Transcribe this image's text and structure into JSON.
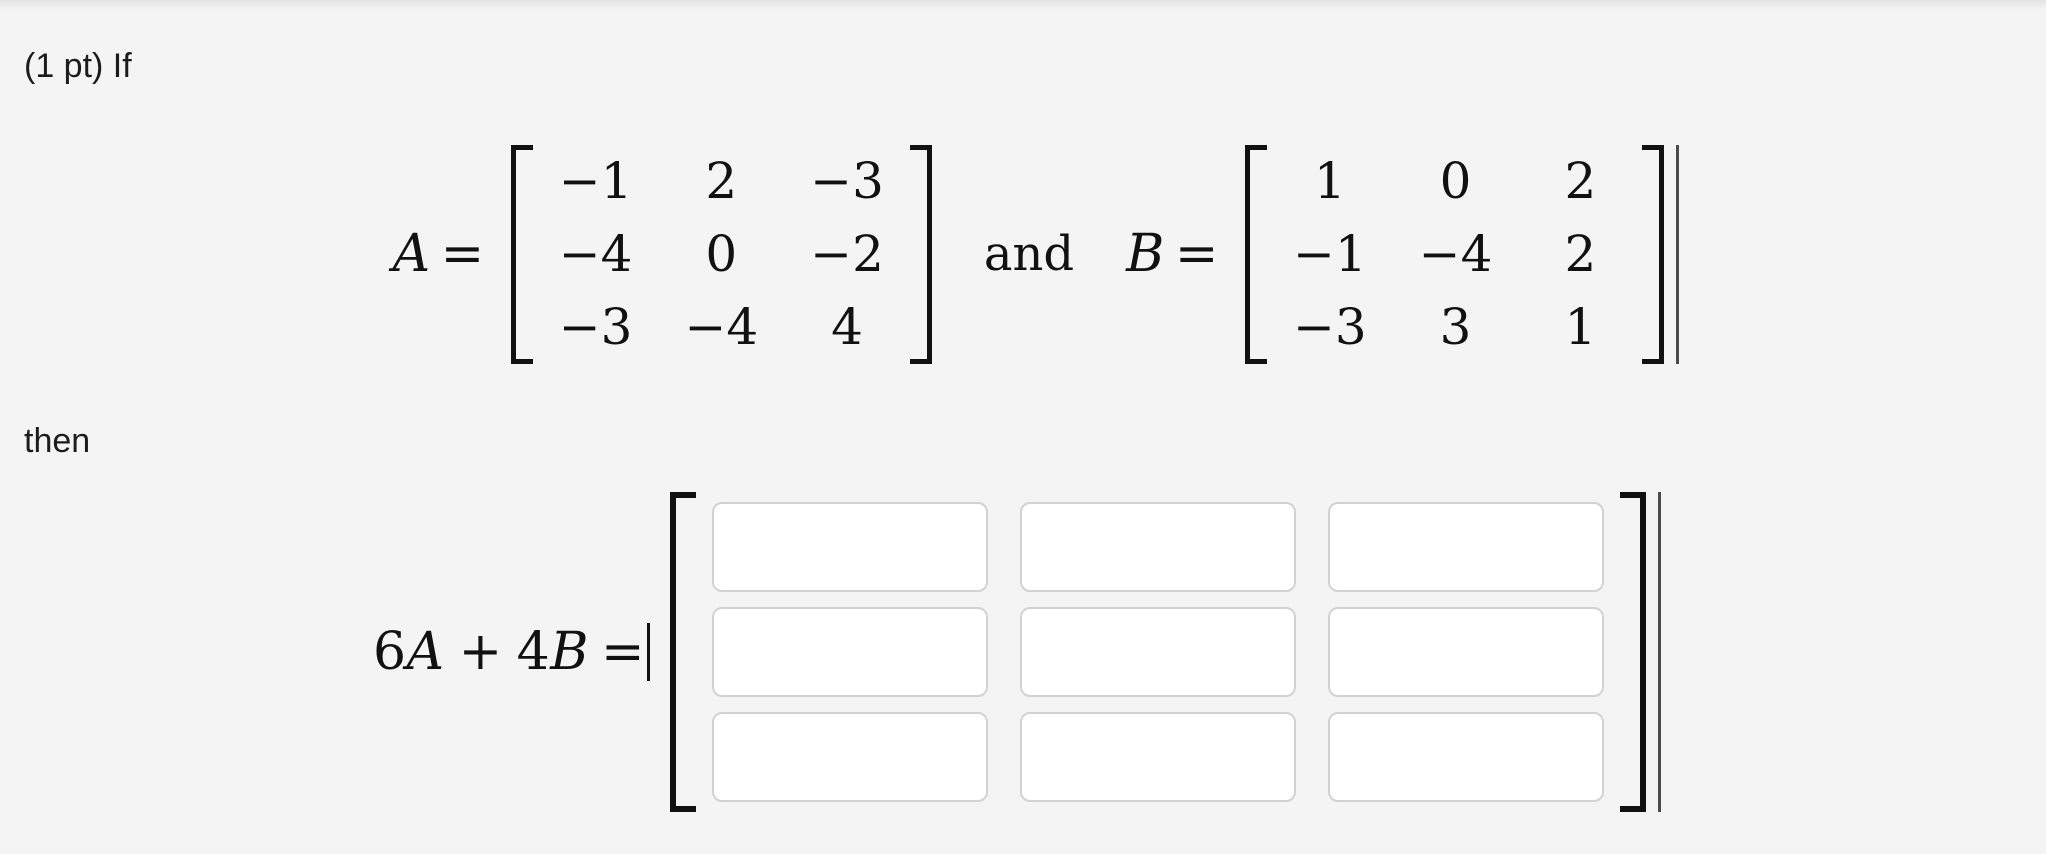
{
  "problem": {
    "intro": "(1 pt) If",
    "then": "then"
  },
  "given": {
    "matrix_a": {
      "label_name": "A",
      "label_equals": "=",
      "rows": [
        [
          "−1",
          "2",
          "−3"
        ],
        [
          "−4",
          "0",
          "−2"
        ],
        [
          "−3",
          "−4",
          "4"
        ]
      ]
    },
    "conjunction": "and",
    "matrix_b": {
      "label_name": "B",
      "label_equals": "=",
      "rows": [
        [
          "1",
          "0",
          "2"
        ],
        [
          "−1",
          "−4",
          "2"
        ],
        [
          "−3",
          "3",
          "1"
        ]
      ]
    }
  },
  "answer": {
    "expression_coefficient_a": "6",
    "expression_name_a": "A",
    "expression_plus": "+",
    "expression_coefficient_b": "4",
    "expression_name_b": "B",
    "expression_equals": "=",
    "inputs": [
      [
        {
          "name": "answer-r1c1",
          "value": "",
          "placeholder": ""
        },
        {
          "name": "answer-r1c2",
          "value": "",
          "placeholder": ""
        },
        {
          "name": "answer-r1c3",
          "value": "",
          "placeholder": ""
        }
      ],
      [
        {
          "name": "answer-r2c1",
          "value": "",
          "placeholder": ""
        },
        {
          "name": "answer-r2c2",
          "value": "",
          "placeholder": ""
        },
        {
          "name": "answer-r2c3",
          "value": "",
          "placeholder": ""
        }
      ],
      [
        {
          "name": "answer-r3c1",
          "value": "",
          "placeholder": ""
        },
        {
          "name": "answer-r3c2",
          "value": "",
          "placeholder": ""
        },
        {
          "name": "answer-r3c3",
          "value": "",
          "placeholder": ""
        }
      ]
    ]
  },
  "colors": {
    "page_background": "#f4f4f4",
    "text": "#1c1c1c",
    "math": "#111111",
    "input_background": "#ffffff",
    "input_border": "#d2d2d2",
    "bracket": "#111111"
  }
}
